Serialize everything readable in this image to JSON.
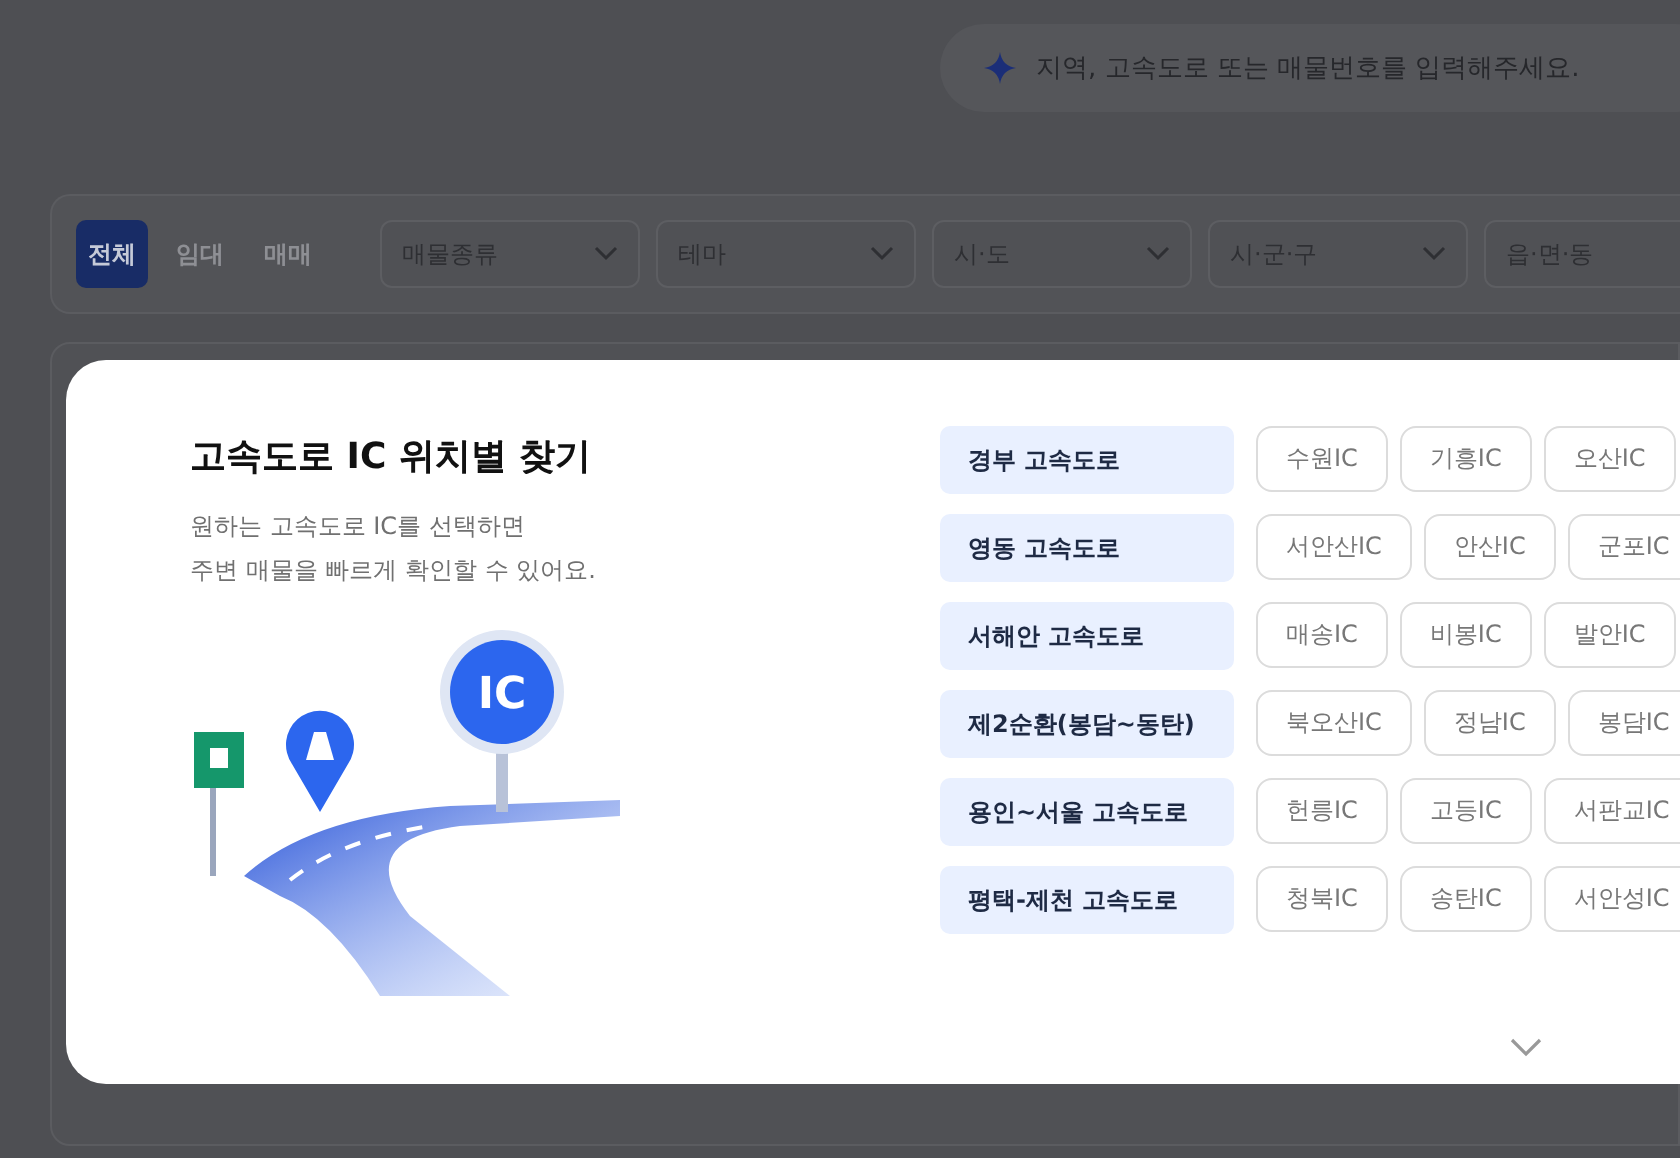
{
  "search": {
    "placeholder": "지역, 고속도로 또는 매물번호를 입력해주세요."
  },
  "filter_tabs": [
    {
      "label": "전체",
      "selected": true
    },
    {
      "label": "임대",
      "selected": false
    },
    {
      "label": "매매",
      "selected": false
    }
  ],
  "dropdowns": [
    "매물종류",
    "테마",
    "시·도",
    "시·군·구",
    "읍·면·동"
  ],
  "modal": {
    "title": "고속도로 IC 위치별 찾기",
    "description": [
      "원하는 고속도로 IC를 선택하면",
      "주변 매물을 빠르게 확인할 수 있어요."
    ],
    "sign_label": "IC",
    "highways": [
      {
        "name": "경부 고속도로",
        "interchanges": [
          "수원IC",
          "기흥IC",
          "오산IC"
        ]
      },
      {
        "name": "영동 고속도로",
        "interchanges": [
          "서안산IC",
          "안산IC",
          "군포IC"
        ]
      },
      {
        "name": "서해안 고속도로",
        "interchanges": [
          "매송IC",
          "비봉IC",
          "발안IC"
        ]
      },
      {
        "name": "제2순환(봉담~동탄)",
        "interchanges": [
          "북오산IC",
          "정남IC",
          "봉담IC"
        ]
      },
      {
        "name": "용인~서울 고속도로",
        "interchanges": [
          "헌릉IC",
          "고등IC",
          "서판교IC"
        ]
      },
      {
        "name": "평택-제천 고속도로",
        "interchanges": [
          "청북IC",
          "송탄IC",
          "서안성IC"
        ]
      }
    ]
  }
}
